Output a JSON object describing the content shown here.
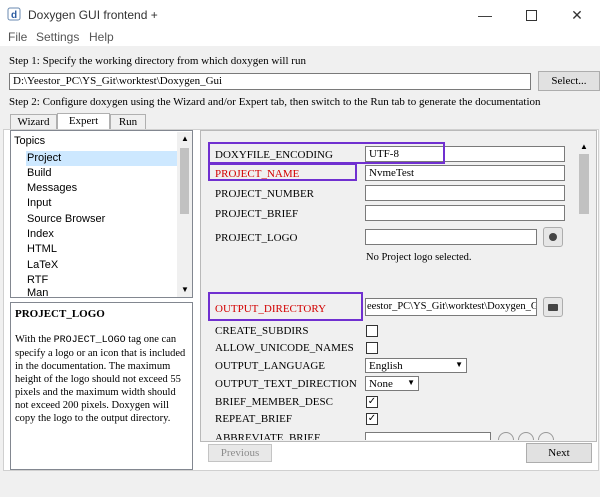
{
  "window": {
    "title": "Doxygen GUI frontend +"
  },
  "menu": [
    "File",
    "Settings",
    "Help"
  ],
  "step1": {
    "label": "Step 1: Specify the working directory from which doxygen will run",
    "path": "D:\\Yeestor_PC\\YS_Git\\worktest\\Doxygen_Gui",
    "select_label": "Select..."
  },
  "step2": {
    "label": "Step 2: Configure doxygen using the Wizard and/or Expert tab, then switch to the Run tab to generate the documentation"
  },
  "tabs": [
    "Wizard",
    "Expert",
    "Run"
  ],
  "topics": {
    "header": "Topics",
    "items": [
      "Project",
      "Build",
      "Messages",
      "Input",
      "Source Browser",
      "Index",
      "HTML",
      "LaTeX",
      "RTF",
      "Man"
    ]
  },
  "help": {
    "title": "PROJECT_LOGO",
    "text_pre": "With the ",
    "tag": "PROJECT_LOGO",
    "text_post": " tag one can specify a logo or an icon that is included in the documentation. The maximum height of the logo should not exceed 55 pixels and the maximum width should not exceed 200 pixels. Doxygen will copy the logo to the output directory."
  },
  "settings": {
    "doxyfile_encoding": {
      "label": "DOXYFILE_ENCODING",
      "value": "UTF-8"
    },
    "project_name": {
      "label": "PROJECT_NAME",
      "value": "NvmeTest"
    },
    "project_number": {
      "label": "PROJECT_NUMBER",
      "value": ""
    },
    "project_brief": {
      "label": "PROJECT_BRIEF",
      "value": ""
    },
    "project_logo": {
      "label": "PROJECT_LOGO",
      "value": "",
      "note": "No Project logo selected."
    },
    "output_directory": {
      "label": "OUTPUT_DIRECTORY",
      "value": "eestor_PC\\YS_Git\\worktest\\Doxygen_Gui"
    },
    "create_subdirs": {
      "label": "CREATE_SUBDIRS",
      "checked": false
    },
    "allow_unicode_names": {
      "label": "ALLOW_UNICODE_NAMES",
      "checked": false
    },
    "output_language": {
      "label": "OUTPUT_LANGUAGE",
      "value": "English"
    },
    "output_text_direction": {
      "label": "OUTPUT_TEXT_DIRECTION",
      "value": "None"
    },
    "brief_member_desc": {
      "label": "BRIEF_MEMBER_DESC",
      "checked": true
    },
    "repeat_brief": {
      "label": "REPEAT_BRIEF",
      "checked": true
    },
    "abbreviate_brief": {
      "label": "ABBREVIATE_BRIEF"
    }
  },
  "nav": {
    "previous": "Previous",
    "next": "Next"
  },
  "colors": {
    "highlight": "#7030d0",
    "required_label": "#d20000",
    "selected_topic": "#cde8ff"
  },
  "icons": {
    "app": "doxygen-app-icon",
    "folder": "folder-icon",
    "file": "file-icon"
  }
}
